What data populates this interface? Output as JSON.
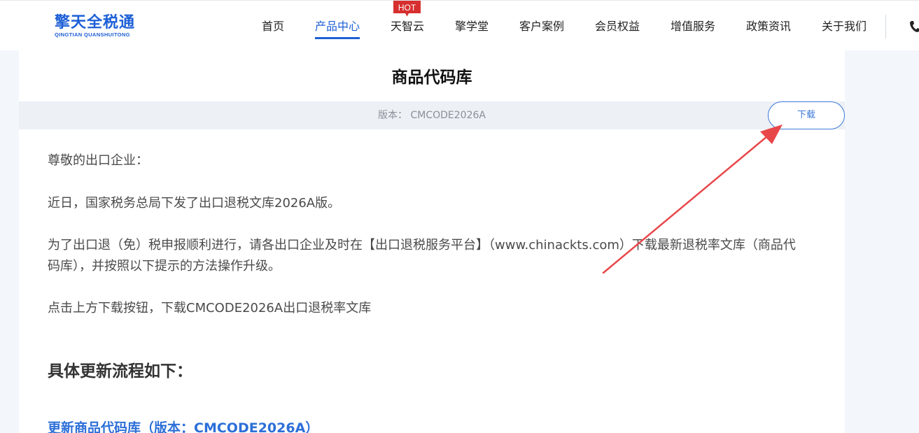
{
  "header": {
    "logo": {
      "name_cn": "擎天全税通",
      "name_en": "QINGTIAN QUANSHUITONG"
    },
    "nav": [
      {
        "label": "首页"
      },
      {
        "label": "产品中心",
        "active": true
      },
      {
        "label": "天智云",
        "badge": "HOT"
      },
      {
        "label": "擎学堂"
      },
      {
        "label": "客户案例"
      },
      {
        "label": "会员权益"
      },
      {
        "label": "增值服务"
      },
      {
        "label": "政策资讯"
      },
      {
        "label": "关于我们"
      }
    ],
    "phone_icon": "phone-icon"
  },
  "main": {
    "title": "商品代码库",
    "version_text": "版本： CMCODE2026A",
    "download_label": "下载",
    "paragraphs": [
      "尊敬的出口企业：",
      "近日，国家税务总局下发了出口退税文库2026A版。",
      "为了出口退（免）税申报顺利进行，请各出口企业及时在【出口退税服务平台】（www.chinackts.com）下载最新退税率文库（商品代",
      "码库），并按照以下提示的方法操作升级。",
      "点击上方下载按钮，下载CMCODE2026A出口退税率文库"
    ],
    "section_heading": "具体更新流程如下：",
    "update_link": "更新商品代码库（版本：CMCODE2026A）"
  },
  "colors": {
    "brand": "#1d5fd6",
    "hot_badge": "#d72f2f",
    "arrow": "#e8474a",
    "link": "#2c6fd8"
  },
  "annotation": {
    "arrow_icon": "annotation-arrow"
  }
}
